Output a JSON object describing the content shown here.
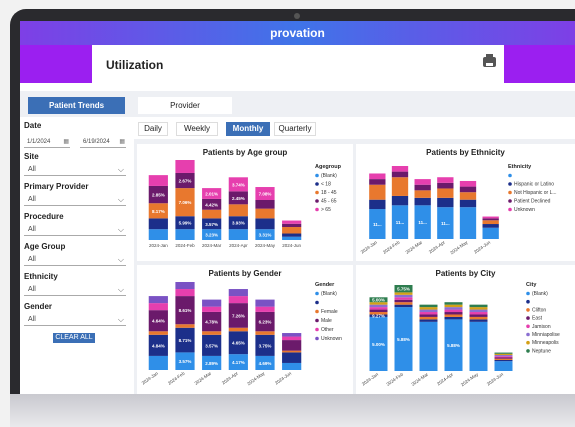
{
  "app": {
    "brand": "provation",
    "page_title": "Utilization"
  },
  "tabs": [
    "Patient Trends",
    "Provider"
  ],
  "granularity": [
    "Daily",
    "Weekly",
    "Monthly",
    "Quarterly"
  ],
  "filters": {
    "date_label": "Date",
    "date_from": "1/1/2024",
    "date_to": "6/19/2024",
    "site": {
      "label": "Site",
      "value": "All"
    },
    "primary_provider": {
      "label": "Primary Provider",
      "value": "All"
    },
    "procedure": {
      "label": "Procedure",
      "value": "All"
    },
    "age_group": {
      "label": "Age Group",
      "value": "All"
    },
    "ethnicity": {
      "label": "Ethnicity",
      "value": "All"
    },
    "gender": {
      "label": "Gender",
      "value": "All"
    },
    "clear_label": "CLEAR ALL"
  },
  "icons": {
    "printer": "printer-icon",
    "chevron": "chevron-down-icon",
    "calendar": "calendar-icon"
  },
  "colors": {
    "accent": "#3b6fb6",
    "brand_gradient": [
      "#7e3fe6",
      "#3f74e8"
    ],
    "header_band": "#9b1ff0"
  },
  "chart_data": [
    {
      "type": "bar",
      "title": "Patients by Age group",
      "legend_title": "Agegroup",
      "categories": [
        "2024-Jan",
        "2024-Feb",
        "2024-Mar",
        "2024-Apr",
        "2024-May",
        "2024-Jun"
      ],
      "series": [
        {
          "name": "(Blank)",
          "color": "#2f8fe8",
          "values": [
            1,
            1,
            1,
            1,
            1,
            0.3
          ]
        },
        {
          "name": "< 18",
          "color": "#1c2f8a",
          "values": [
            1,
            1.2,
            1,
            1.2,
            1,
            0.3
          ]
        },
        {
          "name": "18 - 45",
          "color": "#e8782e",
          "values": [
            1.4,
            2.6,
            0.8,
            1.1,
            0.9,
            0.6
          ]
        },
        {
          "name": "45 - 65",
          "color": "#6b1a6b",
          "values": [
            1.6,
            1.4,
            1,
            1.2,
            0.8,
            0.3
          ]
        },
        {
          "name": "> 65",
          "color": "#e63fae",
          "values": [
            1,
            1.2,
            1,
            1.3,
            1.2,
            0.3
          ]
        }
      ],
      "data_labels": [
        [
          "2.85%",
          "8.17%"
        ],
        [
          "7.06%",
          "2.67%",
          "5.99%"
        ],
        [
          "3.23%",
          "3.57%",
          "4.42%",
          "2.01%"
        ],
        [
          "3.74%",
          "3.93%",
          "2.45%"
        ],
        [
          "7.08%",
          "3.31%"
        ],
        []
      ]
    },
    {
      "type": "bar",
      "title": "Patients by Ethnicity",
      "legend_title": "Ethnicity",
      "categories": [
        "2024-Jan",
        "2024-Feb",
        "2024-Mar",
        "2024-Apr",
        "2024-May",
        "2024-Jun"
      ],
      "series": [
        {
          "name": "",
          "color": "#2f8fe8",
          "values": [
            1.6,
            1.8,
            1.8,
            1.7,
            1.7,
            0.6
          ]
        },
        {
          "name": "Hispanic or Latino",
          "color": "#1c2f8a",
          "values": [
            0.5,
            0.5,
            0.4,
            0.5,
            0.4,
            0.2
          ]
        },
        {
          "name": "Not Hispanic or L...",
          "color": "#e8782e",
          "values": [
            0.8,
            1,
            0.4,
            0.5,
            0.4,
            0.2
          ]
        },
        {
          "name": "Patient Declined",
          "color": "#6b1a6b",
          "values": [
            0.3,
            0.3,
            0.3,
            0.3,
            0.3,
            0.1
          ]
        },
        {
          "name": "Unknown",
          "color": "#e63fae",
          "values": [
            0.3,
            0.3,
            0.3,
            0.3,
            0.3,
            0.1
          ]
        }
      ],
      "data_labels": [
        [
          "11..."
        ],
        [
          "11..."
        ],
        [
          "11..."
        ],
        [
          "11..."
        ],
        [],
        []
      ]
    },
    {
      "type": "bar",
      "title": "Patients by Gender",
      "legend_title": "Gender",
      "categories": [
        "2024-Jan",
        "2024-Feb",
        "2024-Mar",
        "2024-Apr",
        "2024-May",
        "2024-Jun"
      ],
      "series": [
        {
          "name": "(Blank)",
          "color": "#2f8fe8",
          "values": [
            0.8,
            1,
            0.8,
            0.9,
            0.8,
            0.4
          ]
        },
        {
          "name": "",
          "color": "#1c2f8a",
          "values": [
            1.2,
            1.4,
            1.2,
            1.3,
            1.2,
            0.6
          ]
        },
        {
          "name": "Female",
          "color": "#e8782e",
          "values": [
            0.2,
            0.2,
            0.2,
            0.2,
            0.2,
            0.1
          ]
        },
        {
          "name": "Male",
          "color": "#6b1a6b",
          "values": [
            1.2,
            1.6,
            1.1,
            1.4,
            1.1,
            0.6
          ]
        },
        {
          "name": "Other",
          "color": "#e63fae",
          "values": [
            0.4,
            0.4,
            0.3,
            0.4,
            0.3,
            0.2
          ]
        },
        {
          "name": "Unknown",
          "color": "#7a52c4",
          "values": [
            0.4,
            0.4,
            0.4,
            0.4,
            0.4,
            0.2
          ]
        }
      ],
      "data_labels": [
        [
          "4.84%",
          "4.64%"
        ],
        [
          "8.61%",
          "8.71%",
          "3.57%"
        ],
        [
          "3.57%",
          "4.78%",
          "2.89%"
        ],
        [
          "7.26%",
          "4.65%",
          "4.17%"
        ],
        [
          "3.75%",
          "6.23%",
          "4.69%"
        ],
        []
      ]
    },
    {
      "type": "bar",
      "title": "Patients by City",
      "legend_title": "City",
      "categories": [
        "2024-Jan",
        "2024-Feb",
        "2024-Mar",
        "2024-Apr",
        "2024-May",
        "2024-Jun"
      ],
      "series": [
        {
          "name": "(Blank)",
          "color": "#2f8fe8",
          "values": [
            2.2,
            2.6,
            2,
            2.1,
            2,
            0.4
          ]
        },
        {
          "name": "",
          "color": "#1c2f8a",
          "values": [
            0.1,
            0.1,
            0.1,
            0.1,
            0.1,
            0.05
          ]
        },
        {
          "name": "Clifton",
          "color": "#e8782e",
          "values": [
            0.1,
            0.1,
            0.1,
            0.1,
            0.1,
            0.05
          ]
        },
        {
          "name": "East",
          "color": "#6b1a6b",
          "values": [
            0.1,
            0.1,
            0.1,
            0.1,
            0.1,
            0.05
          ]
        },
        {
          "name": "Jamison",
          "color": "#e63fae",
          "values": [
            0.1,
            0.1,
            0.1,
            0.1,
            0.1,
            0.05
          ]
        },
        {
          "name": "Minniapolise",
          "color": "#8a6fd1",
          "values": [
            0.1,
            0.1,
            0.1,
            0.1,
            0.1,
            0.05
          ]
        },
        {
          "name": "Minneapolis",
          "color": "#d4a017",
          "values": [
            0.1,
            0.1,
            0.1,
            0.1,
            0.1,
            0.05
          ]
        },
        {
          "name": "Neptune",
          "color": "#2e7d4f",
          "values": [
            0.2,
            0.3,
            0.1,
            0.1,
            0.1,
            0.05
          ]
        }
      ],
      "data_labels": [
        [
          "5.00%",
          "5.00%",
          "9.27%"
        ],
        [
          "5.88%",
          "5.75%"
        ],
        [],
        [
          "5.88%"
        ],
        [],
        []
      ]
    }
  ]
}
